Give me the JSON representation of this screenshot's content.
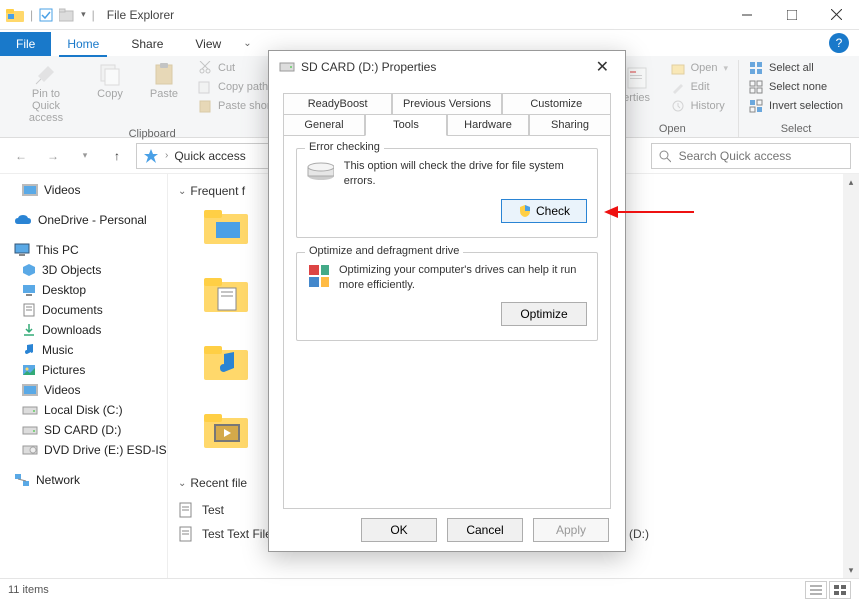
{
  "window": {
    "title": "File Explorer"
  },
  "ribbon_tabs": {
    "file": "File",
    "home": "Home",
    "share": "Share",
    "view": "View"
  },
  "ribbon": {
    "clipboard_group": "Clipboard",
    "pin": "Pin to Quick access",
    "copy": "Copy",
    "paste": "Paste",
    "cut": "Cut",
    "copy_path": "Copy path",
    "paste_shortcut": "Paste shortcut",
    "open_group": "Open",
    "open": "Open",
    "edit": "Edit",
    "history": "History",
    "properties_trunc": "erties",
    "select_group": "Select",
    "select_all": "Select all",
    "select_none": "Select none",
    "invert": "Invert selection"
  },
  "breadcrumb": {
    "root": "Quick access"
  },
  "search": {
    "placeholder": "Search Quick access"
  },
  "sidebar": {
    "videos_top": "Videos",
    "onedrive": "OneDrive - Personal",
    "this_pc": "This PC",
    "objects3d": "3D Objects",
    "desktop": "Desktop",
    "documents": "Documents",
    "downloads": "Downloads",
    "music": "Music",
    "pictures": "Pictures",
    "videos": "Videos",
    "local_disk": "Local Disk (C:)",
    "sd_card": "SD CARD (D:)",
    "dvd": "DVD Drive (E:) ESD-IS",
    "network": "Network"
  },
  "content": {
    "group_frequent": "Frequent f",
    "group_recent": "Recent file",
    "file1": "Test",
    "file2": "Test Text File",
    "file2_loc": "SD CARD (D:)"
  },
  "status": {
    "items": "11 items"
  },
  "dialog": {
    "title": "SD CARD (D:) Properties",
    "tabs": {
      "readyboost": "ReadyBoost",
      "previous": "Previous Versions",
      "customize": "Customize",
      "general": "General",
      "tools": "Tools",
      "hardware": "Hardware",
      "sharing": "Sharing"
    },
    "error_check": {
      "legend": "Error checking",
      "text": "This option will check the drive for file system errors.",
      "button": "Check"
    },
    "optimize": {
      "legend": "Optimize and defragment drive",
      "text": "Optimizing your computer's drives can help it run more efficiently.",
      "button": "Optimize"
    },
    "buttons": {
      "ok": "OK",
      "cancel": "Cancel",
      "apply": "Apply"
    }
  }
}
